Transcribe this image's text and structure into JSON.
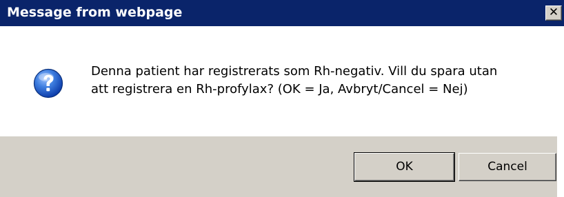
{
  "window": {
    "title": "Message from webpage",
    "close_glyph": "✕",
    "title_bar_color": "#0a246a"
  },
  "message": {
    "line1": "Denna patient har registrerats som Rh-negativ. Vill du spara utan",
    "line2": "att registrera en Rh-profylax? (OK = Ja, Avbryt/Cancel = Nej)",
    "icon": "question-icon"
  },
  "buttons": {
    "ok_label": "OK",
    "cancel_label": "Cancel"
  }
}
